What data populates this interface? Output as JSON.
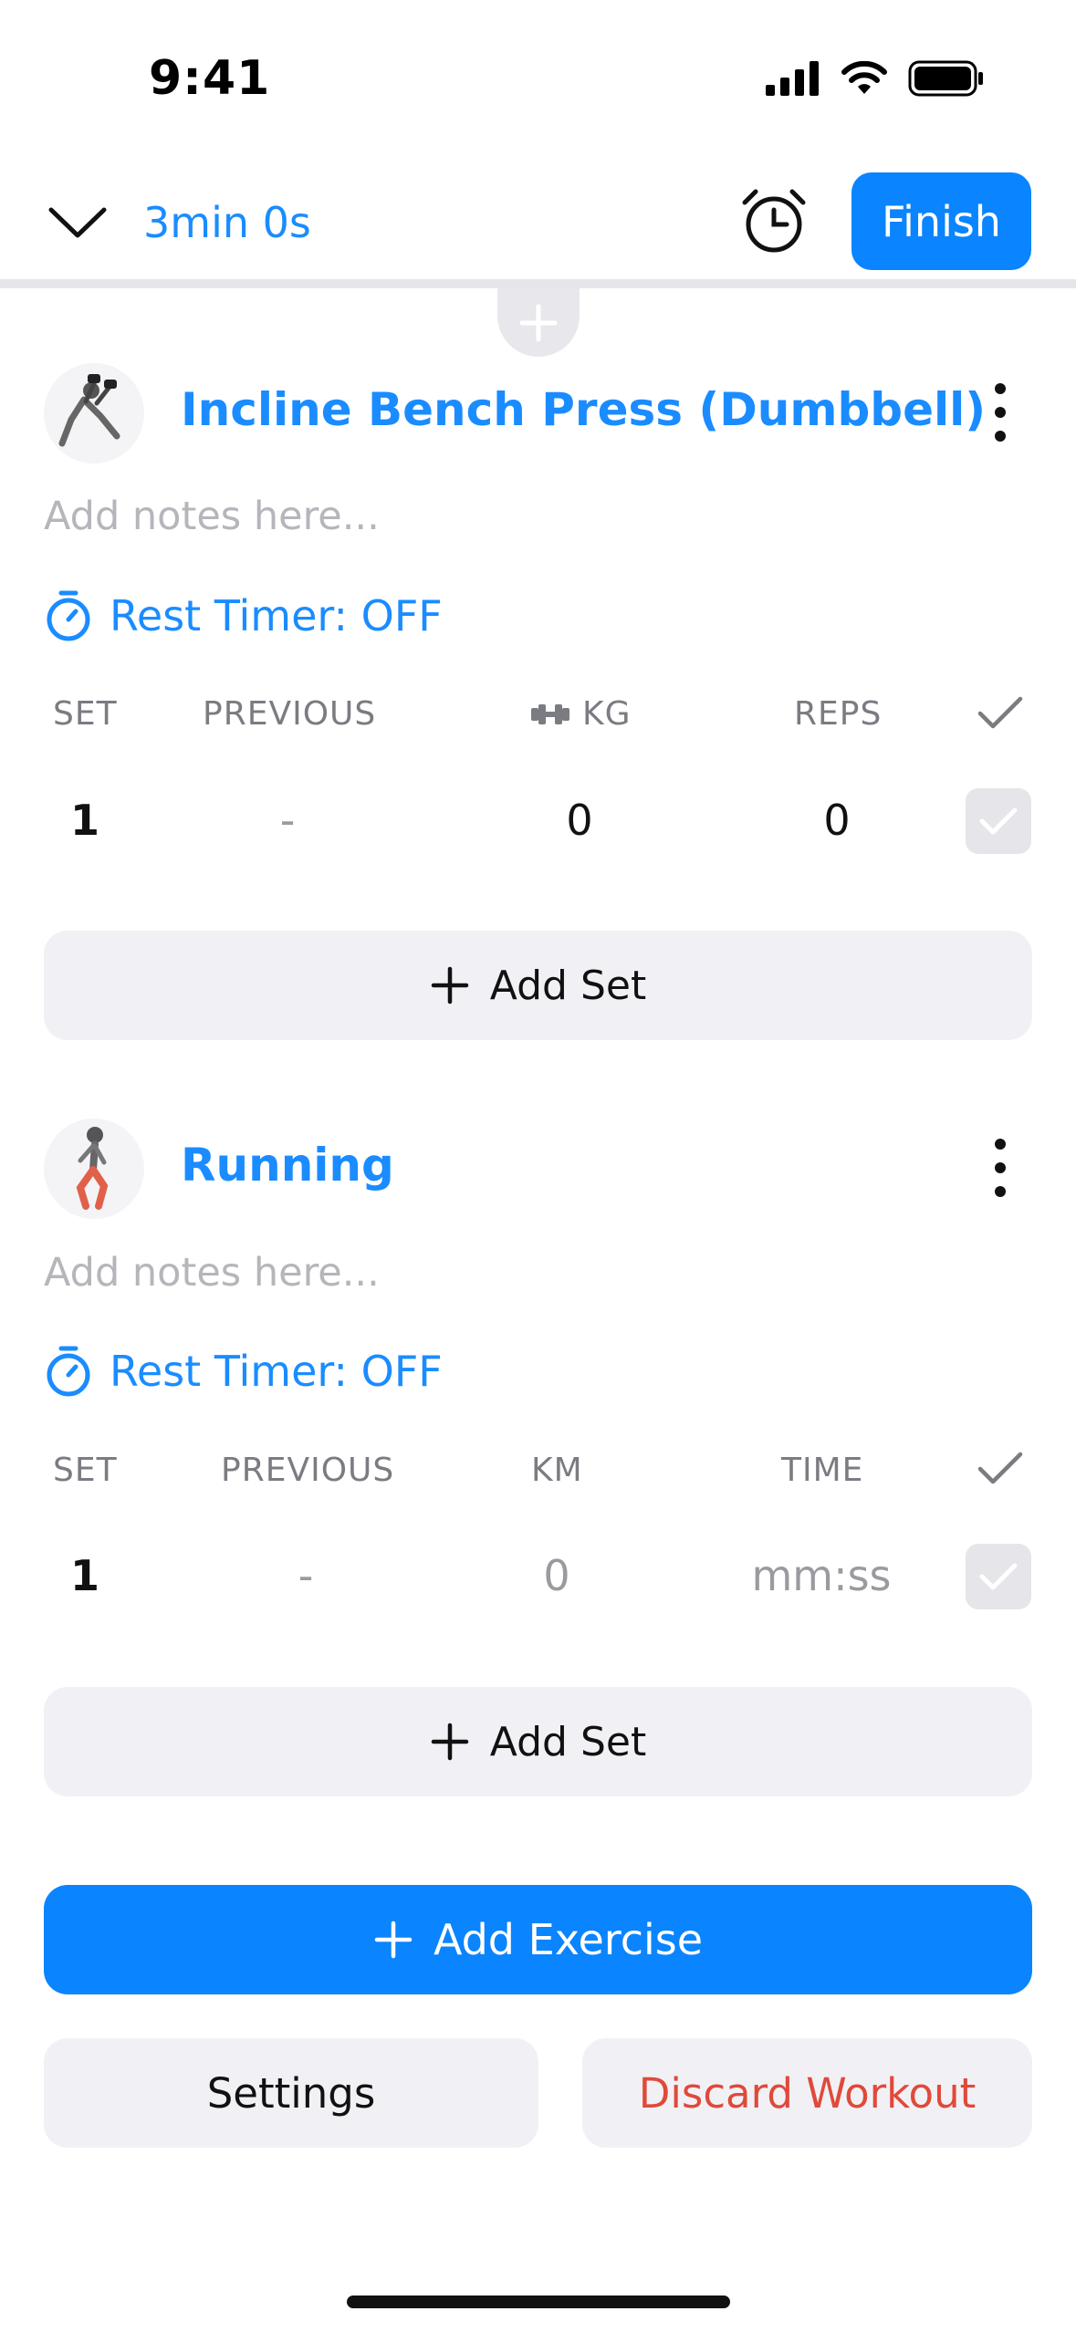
{
  "status_bar": {
    "time": "9:41"
  },
  "header": {
    "elapsed": "3min 0s",
    "finish_label": "Finish"
  },
  "exercises": [
    {
      "title": "Incline Bench Press (Dumbbell)",
      "notes_placeholder": "Add notes here...",
      "rest_timer": "Rest Timer: OFF",
      "columns": {
        "set": "SET",
        "previous": "PREVIOUS",
        "value1": "KG",
        "value2": "REPS"
      },
      "rows": [
        {
          "set": "1",
          "previous": "-",
          "value1": "0",
          "value2": "0"
        }
      ],
      "add_set_label": "Add Set"
    },
    {
      "title": "Running",
      "notes_placeholder": "Add notes here...",
      "rest_timer": "Rest Timer: OFF",
      "columns": {
        "set": "SET",
        "previous": "PREVIOUS",
        "value1": "KM",
        "value2": "TIME"
      },
      "rows": [
        {
          "set": "1",
          "previous": "-",
          "value1": "0",
          "value2": "mm:ss"
        }
      ],
      "add_set_label": "Add Set"
    }
  ],
  "actions": {
    "add_exercise_label": "Add Exercise",
    "settings_label": "Settings",
    "discard_label": "Discard Workout"
  },
  "colors": {
    "accent": "#0a84ff",
    "danger": "#e0493a",
    "muted": "#b5b5bb"
  }
}
